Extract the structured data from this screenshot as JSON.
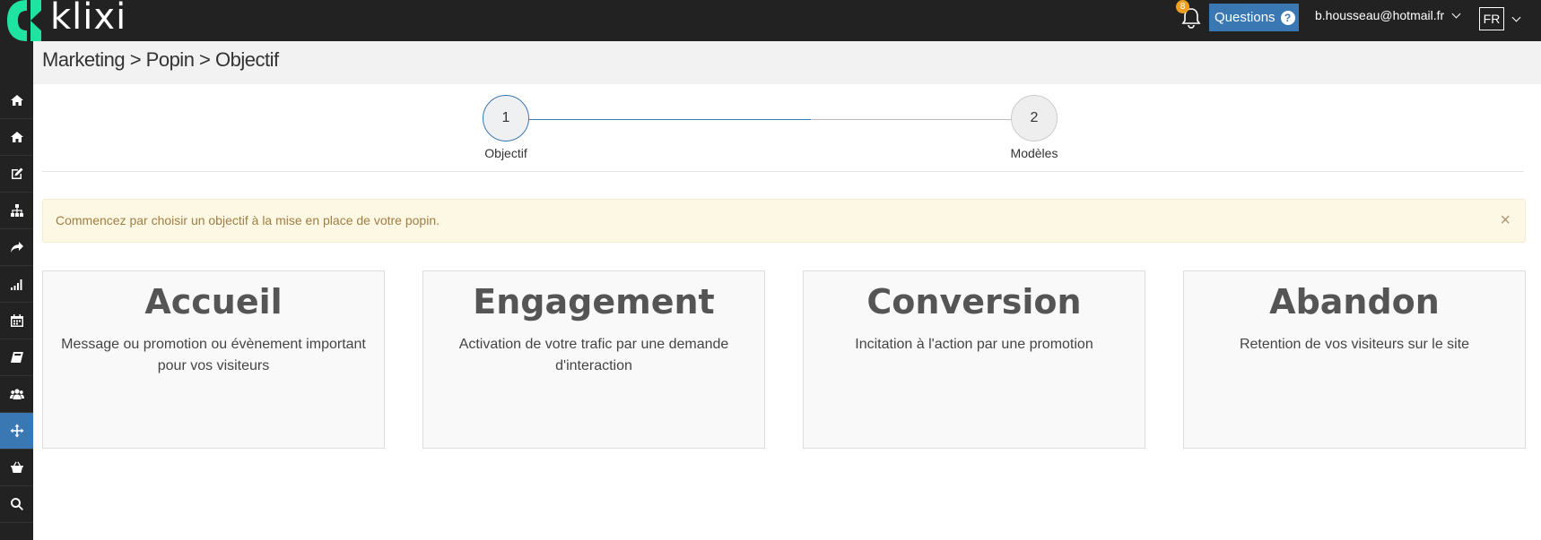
{
  "header": {
    "logo_text": "klixi",
    "brand_color": "#1fe3a0",
    "notifications_count": "8",
    "questions_label": "Questions",
    "user_email": "b.housseau@hotmail.fr",
    "language": "FR"
  },
  "sidebar": {
    "items": [
      {
        "icon": "home-icon"
      },
      {
        "icon": "home-icon"
      },
      {
        "icon": "edit-icon"
      },
      {
        "icon": "sitemap-icon"
      },
      {
        "icon": "share-icon"
      },
      {
        "icon": "signal-icon"
      },
      {
        "icon": "calendar-icon"
      },
      {
        "icon": "book-icon"
      },
      {
        "icon": "users-icon"
      },
      {
        "icon": "crosshairs-icon",
        "active": true
      },
      {
        "icon": "basket-icon"
      },
      {
        "icon": "search-icon"
      }
    ],
    "active_color": "#3a78b4"
  },
  "breadcrumb": "Marketing > Popin > Objectif",
  "stepper": {
    "steps": [
      {
        "number": "1",
        "label": "Objectif"
      },
      {
        "number": "2",
        "label": "Modèles"
      }
    ]
  },
  "alert": {
    "text": "Commencez par choisir un objectif à la mise en place de votre popin.",
    "close": "×"
  },
  "cards": [
    {
      "title": "Accueil",
      "description": "Message ou promotion ou évènement important pour vos visiteurs"
    },
    {
      "title": "Engagement",
      "description": "Activation de votre trafic par une demande d'interaction"
    },
    {
      "title": "Conversion",
      "description": "Incitation à l'action par une promotion"
    },
    {
      "title": "Abandon",
      "description": "Retention de vos visiteurs sur le site"
    }
  ]
}
